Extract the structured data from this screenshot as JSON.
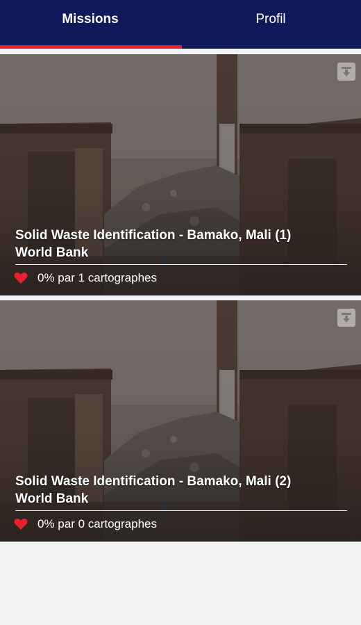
{
  "tabs": [
    {
      "label": "Missions",
      "active": true
    },
    {
      "label": "Profil",
      "active": false
    }
  ],
  "colors": {
    "header_bg": "#0e1a59",
    "tab_indicator": "#e8212e",
    "heart": "#e8212e",
    "background": "#f4f4f6"
  },
  "icons": {
    "download": "download-icon",
    "heart": "heart-icon"
  },
  "missions": [
    {
      "title": "Solid Waste Identification - Bamako, Mali (1)",
      "organization": "World Bank",
      "stats": "0% par 1 cartographes",
      "progress_percent": 0
    },
    {
      "title": "Solid Waste Identification - Bamako, Mali (2)",
      "organization": "World Bank",
      "stats": "0% par 0 cartographes",
      "progress_percent": 0
    }
  ]
}
